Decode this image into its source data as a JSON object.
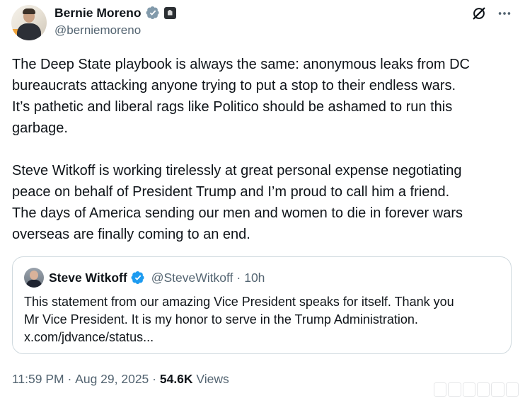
{
  "author": {
    "display_name": "Bernie Moreno",
    "handle": "@berniemoreno",
    "verified_color": "#829aab"
  },
  "actions": {
    "grok_icon": "grok-icon",
    "more_icon": "more-icon"
  },
  "tweet": {
    "text": "The Deep State playbook is always the same: anonymous leaks from DC\nbureaucrats attacking anyone trying to put a stop to their endless wars.\nIt’s pathetic and liberal rags like Politico should be ashamed to run this\ngarbage.\n\nSteve Witkoff is working tirelessly at great personal expense negotiating\npeace on behalf of President Trump and I’m proud to call him a friend.\nThe days of America sending our men and women to die in forever wars\noverseas are finally coming to an end."
  },
  "quote": {
    "display_name": "Steve Witkoff",
    "handle": "@SteveWitkoff",
    "separator": "·",
    "time": "10h",
    "text": "This statement from our amazing Vice President speaks for itself. Thank you\nMr Vice President. It is my honor to serve in the Trump Administration.\nx.com/jdvance/status...",
    "verified_color": "#1d9bf0"
  },
  "meta": {
    "time": "11:59 PM",
    "sep1": " · ",
    "date": "Aug 29, 2025",
    "sep2": " · ",
    "views_count": "54.6K",
    "views_label": " Views"
  }
}
